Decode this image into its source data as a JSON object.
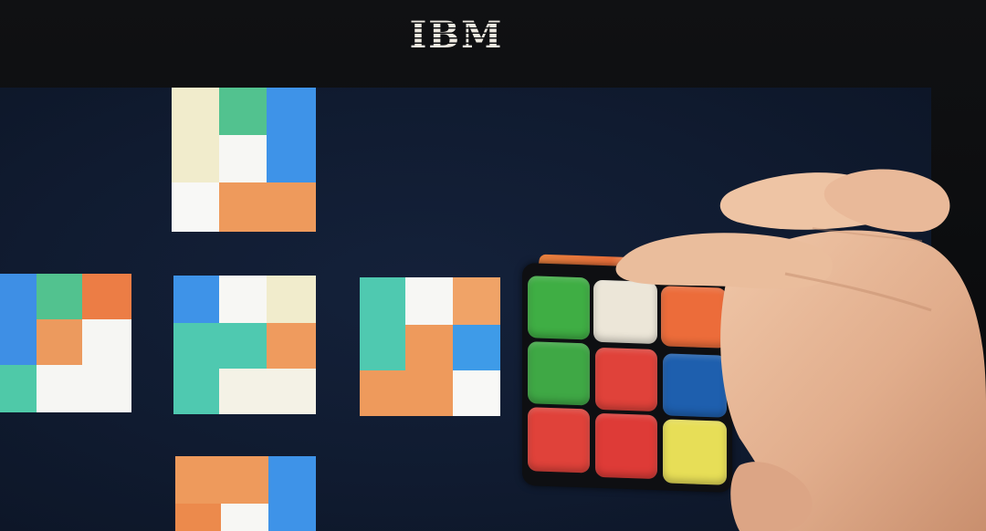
{
  "monitor": {
    "brand_logo": "IBM",
    "bezel_color": "#0b0c0e",
    "screen_background": "#111c31"
  },
  "colors": {
    "cream": "#f1eccc",
    "white": "#f7f7f4",
    "green": "#52c28f",
    "teal": "#4fc9b0",
    "blue": "#3e93e8",
    "orange": "#ec9a5e",
    "light_orange": "#f0a367",
    "cube_green": "#3fae44",
    "cube_red": "#e0423a",
    "cube_orange": "#ec6c3a",
    "cube_white": "#ece6d8",
    "cube_blue": "#1e5fae",
    "cube_yellow": "#e7de57",
    "skin": "#e6b596"
  },
  "net_faces": [
    {
      "name": "top-face"
    },
    {
      "name": "left-face"
    },
    {
      "name": "front-face"
    },
    {
      "name": "right-face"
    },
    {
      "name": "bottom-face"
    }
  ],
  "physical_cube": {
    "front_face_colors": [
      [
        "green",
        "white",
        "orange"
      ],
      [
        "green",
        "red",
        "blue"
      ],
      [
        "red",
        "red",
        "yellow"
      ]
    ]
  }
}
